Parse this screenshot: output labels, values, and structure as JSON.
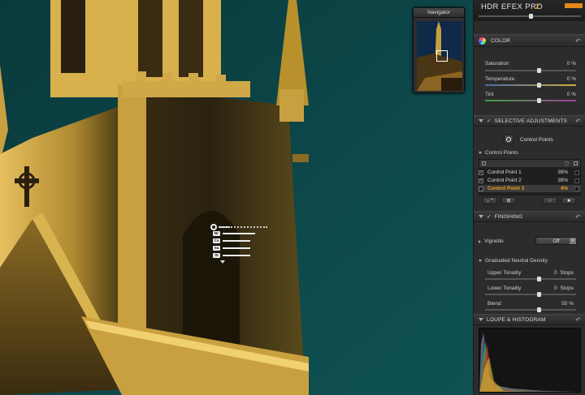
{
  "app": {
    "title": "HDR EFEX PRO",
    "version": "2"
  },
  "navigator": {
    "title": "Navigator"
  },
  "color": {
    "header": "COLOR",
    "saturation": {
      "label": "Saturation",
      "value": "0 %",
      "level": 0.5
    },
    "temperature": {
      "label": "Temperature",
      "value": "0 %",
      "level": 0.5
    },
    "tint": {
      "label": "Tint",
      "value": "0 %",
      "level": 0.5
    }
  },
  "selective": {
    "header": "SELECTIVE ADJUSTMENTS",
    "cp_button": "Control Points",
    "list_label": "Control Points",
    "points": [
      {
        "label": "Control Point 1",
        "opacity": "39%",
        "checked": true
      },
      {
        "label": "Control Point 2",
        "opacity": "39%",
        "checked": true
      },
      {
        "label": "Control Point 3",
        "opacity": "4%",
        "checked": false
      }
    ]
  },
  "finishing": {
    "header": "FINISHING",
    "vignette": {
      "label": "Vignette",
      "value": "Off"
    },
    "gnd": {
      "label": "Graduated Neutral Density"
    },
    "upper": {
      "label": "Upper Tonality",
      "value": "0",
      "unit": "Stops",
      "level": 0.5
    },
    "lower": {
      "label": "Lower Tonality",
      "value": "0",
      "unit": "Stops",
      "level": 0.5
    },
    "blend": {
      "label": "Blend",
      "value": "50",
      "unit": "%",
      "level": 0.5
    }
  },
  "loupe": {
    "header": "LOUPE & HISTOGRAM"
  },
  "colors": {
    "accent": "#f0a020",
    "panel": "#2c2c2c",
    "sky": "#0e4a4c",
    "stone": "#c8a040"
  }
}
